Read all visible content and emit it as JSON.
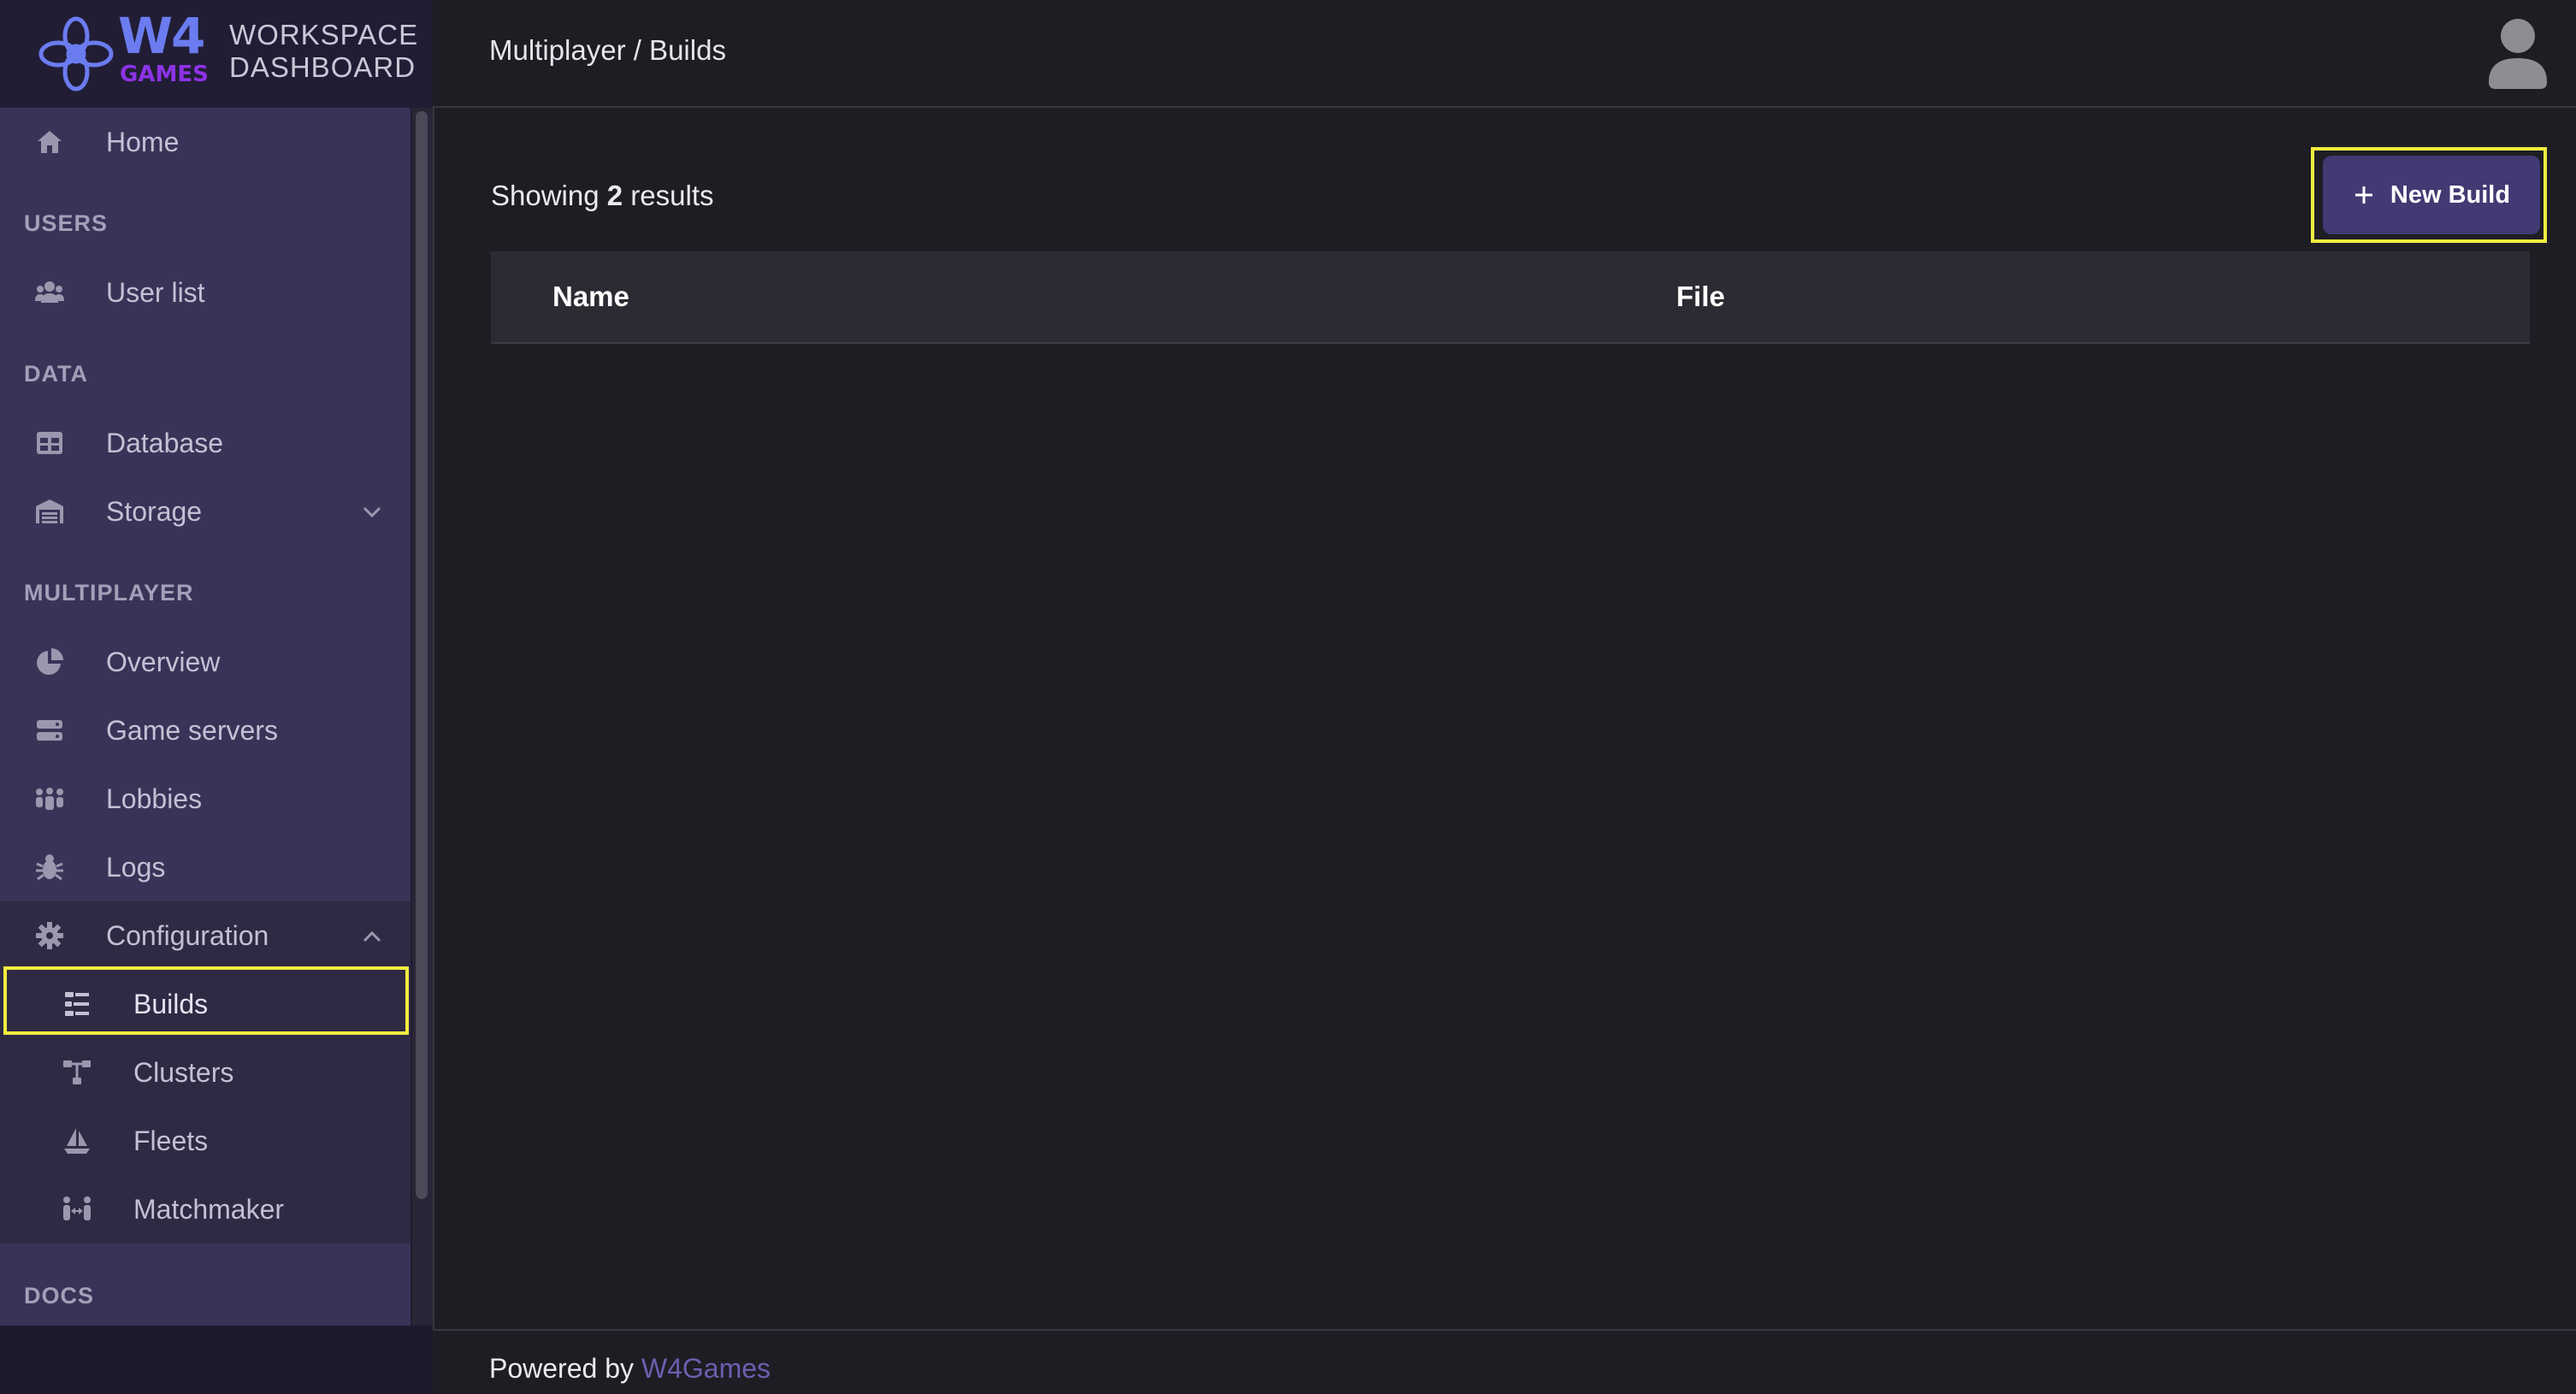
{
  "logo": {
    "brand": "W4",
    "brand_sub": "GAMES",
    "line1": "WORKSPACE",
    "line2": "DASHBOARD"
  },
  "sidebar": {
    "home": "Home",
    "sections": {
      "users": "USERS",
      "data": "DATA",
      "multiplayer": "MULTIPLAYER",
      "docs": "DOCS"
    },
    "items": {
      "user_list": "User list",
      "database": "Database",
      "storage": "Storage",
      "overview": "Overview",
      "game_servers": "Game servers",
      "lobbies": "Lobbies",
      "logs": "Logs",
      "configuration": "Configuration",
      "builds": "Builds",
      "clusters": "Clusters",
      "fleets": "Fleets",
      "matchmaker": "Matchmaker"
    },
    "active_item": "builds"
  },
  "header": {
    "breadcrumb": "Multiplayer / Builds"
  },
  "main": {
    "results_prefix": "Showing",
    "results_count": "2",
    "results_suffix": "results",
    "new_build_label": "New Build",
    "table": {
      "columns": [
        "Name",
        "File"
      ]
    }
  },
  "footer": {
    "prefix": "Powered by",
    "link": "W4Games"
  },
  "colors": {
    "accent": "#423a73",
    "highlight": "#f2ec40",
    "sidebar": "#3a3358"
  }
}
